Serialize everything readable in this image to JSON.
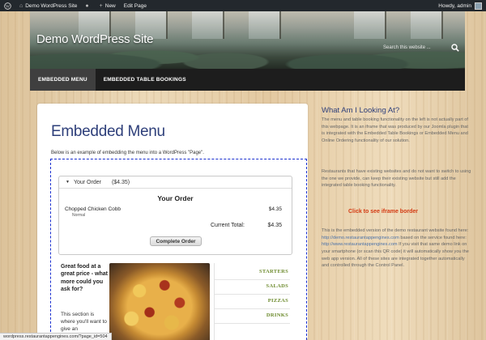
{
  "admin_bar": {
    "site_name": "Demo WordPress Site",
    "comments_icon": "comment-bubble-icon",
    "new_label": "New",
    "edit_label": "Edit Page",
    "greeting": "Howdy, admin"
  },
  "header": {
    "site_title": "Demo WordPress Site",
    "search_placeholder": "Search this website ..."
  },
  "nav": {
    "items": [
      {
        "label": "EMBEDDED MENU",
        "active": true
      },
      {
        "label": "EMBEDDED TABLE BOOKINGS",
        "active": false
      }
    ]
  },
  "main": {
    "title": "Embedded Menu",
    "intro": "Below is an example of embedding the menu into a WordPress \"Page\".",
    "order": {
      "head_label": "Your Order",
      "head_price": "($4.35)",
      "title": "Your Order",
      "item_name": "Chopped Chicken Cobb",
      "item_variant": "Normal",
      "item_price": "$4.35",
      "total_label": "Current Total:",
      "total_value": "$4.35",
      "button": "Complete Order"
    },
    "promo_heading": "Great food at a great price - what more could you ask for?",
    "promo_body": "This section is where you'll want to give an",
    "categories": [
      "STARTERS",
      "SALADS",
      "PIZZAS",
      "DRINKS"
    ]
  },
  "sidebar": {
    "title": "What Am I Looking At?",
    "p1": "The menu and table booking functionality on the left is not actually part of this webpage. It is an iframe that was produced by our Joomla plugin that is integrated with the Embedded Table Bookings or Embedded Menu and Online Ordering functionality of our solution.",
    "p2": "Restaurants that have existing websites and do not want to switch to using the one we provide, can keep their existing website but still add the integrated table booking functionality.",
    "iframe_link": "Click to see iframe border",
    "p3_a": "This is the embedded version of the demo restaurant website found here:",
    "p3_link1": "http://demo.restaurantappengines.com",
    "p3_b": "based on the service found here:",
    "p3_link2": "http://www.restaurantappengines.com",
    "p3_c": "If you visit that same demo link on your smartphone (or scan this QR code) it will automatically show you the web app version. All of these sites are integrated together automatically and controlled through the Control Panel."
  },
  "status_bar": {
    "url": "wordpress.restaurantappengines.com/?page_id=504"
  },
  "colors": {
    "accent_blue": "#2e3f7a",
    "link_orange": "#d43a12",
    "category_green": "#6c8a2c",
    "frame_border": "#1a2fd0"
  }
}
